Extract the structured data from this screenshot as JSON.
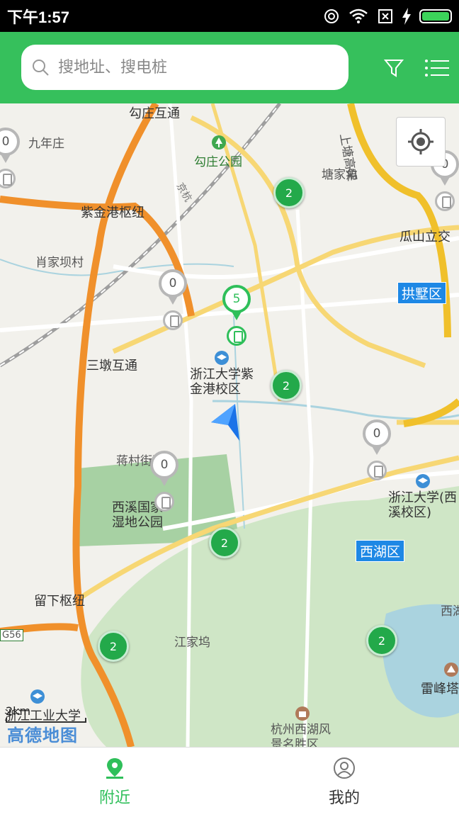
{
  "status_bar": {
    "time": "下午1:57"
  },
  "search": {
    "placeholder": "搜地址、搜电桩"
  },
  "header": {
    "filter_icon": "filter-icon",
    "list_icon": "list-icon"
  },
  "map": {
    "labels": {
      "gouzhuang_interchange": "勾庄互通",
      "jiunianzhuang": "九年庄",
      "gouzhuang_park": "勾庄公园",
      "tangjiajiao": "塘家角",
      "shangtang_elevated": "上塘高架",
      "zijingang_hub": "紫金港枢纽",
      "guashan_interchange": "瓜山立交",
      "xiaojiaba": "肖家坝村",
      "gongshu_district": "拱墅区",
      "sandun_interchange": "三墩互通",
      "zju_zijingang": "浙江大学紫金港校区",
      "zju_xixi": "浙江大学(西溪校区)",
      "jiangcun": "蒋村街道",
      "xixi_wetland": "西溪国家湿地公园",
      "xihu_district": "西湖区",
      "liuxia_hub": "留下枢纽",
      "g56": "G56",
      "jiangjiawu": "江家坞",
      "xihu_lake": "西湖",
      "leifeng_tower": "雷峰塔",
      "hz_scenic": "杭州西湖风景名胜区",
      "zj_tech_univ": "浙江工业大学",
      "jingtang_railway": "京杭"
    },
    "clusters": [
      {
        "count": "2"
      },
      {
        "count": "2"
      },
      {
        "count": "2"
      },
      {
        "count": "2"
      },
      {
        "count": "2"
      }
    ],
    "pins": [
      {
        "count": "0"
      },
      {
        "count": "0"
      },
      {
        "count": "5"
      },
      {
        "count": "0"
      },
      {
        "count": "0"
      },
      {
        "count": "0"
      }
    ],
    "scale": "2km",
    "logo": "高德地图"
  },
  "tabs": [
    {
      "label": "附近",
      "icon": "location-pin-icon",
      "active": true
    },
    {
      "label": "我的",
      "icon": "user-icon",
      "active": false
    }
  ],
  "colors": {
    "brand": "#36c05c",
    "cluster": "#23a94a",
    "accent_blue": "#1e88e5"
  }
}
